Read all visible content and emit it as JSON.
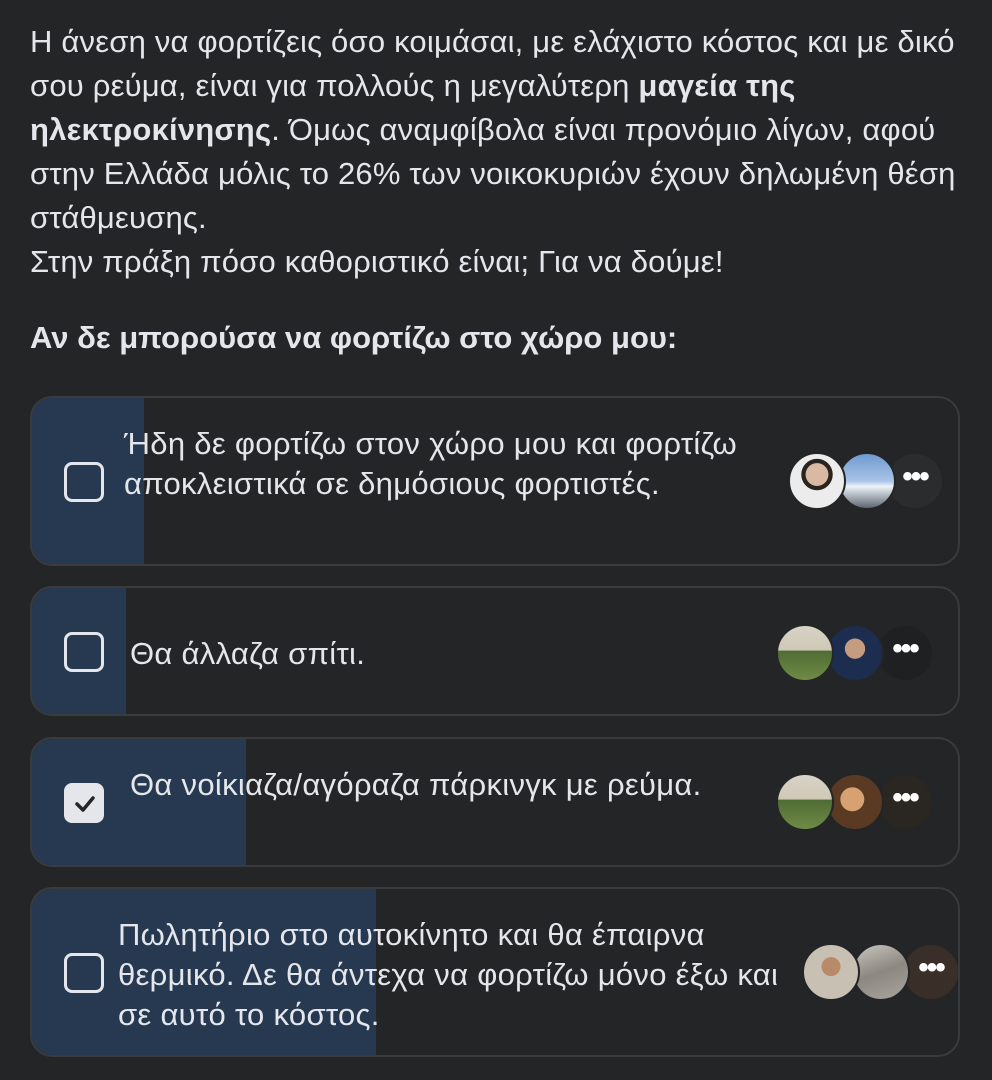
{
  "post": {
    "para1_part1": "Η άνεση να φορτίζεις όσο κοιμάσαι, με ελάχιστο κόστος και με δικό σου ρεύμα, είναι για πολλούς η μεγαλύτερη ",
    "para1_bold": "μαγεία της ηλεκτροκίνησης",
    "para1_part2": ". Όμως αναμφίβολα είναι προνόμιο λίγων, αφού στην Ελλάδα μόλις το 26% των νοικοκυριών έχουν δηλωμένη θέση στάθμευσης.",
    "para2": "Στην πράξη πόσο καθοριστικό είναι; Για να δούμε!"
  },
  "poll": {
    "question": "Αν δε μπορούσα να φορτίζω στο χώρο μου:",
    "options": [
      {
        "label": "Ήδη δε φορτίζω στον χώρο μου και φορτίζω αποκλειστικά σε δημόσιους φορτιστές.",
        "vote_share": 0.12,
        "checked": false,
        "voter_avatars": [
          "man-portrait-avatar",
          "snowy-landscape-avatar",
          "dark-photo-avatar"
        ]
      },
      {
        "label": "Θα άλλαζα σπίτι.",
        "vote_share": 0.1,
        "checked": false,
        "voter_avatars": [
          "park-bicycle-avatar",
          "man-sunglasses-avatar",
          "dark-bicycle-avatar"
        ]
      },
      {
        "label": "Θα νοίκιαζα/αγόραζα πάρκινγκ με ρεύμα.",
        "vote_share": 0.23,
        "checked": true,
        "voter_avatars": [
          "park-bicycle-avatar",
          "man-warm-light-avatar",
          "dark-portrait-avatar"
        ]
      },
      {
        "label": "Πωλητήριο στο αυτοκίνητο και θα έπαιρνα θερμικό. Δε θα άντεχα να φορτίζω μόνο έξω και σε αυτό το κόστος.",
        "vote_share": 0.37,
        "checked": false,
        "voter_avatars": [
          "man-outdoors-avatar",
          "rocky-mountain-avatar",
          "dark-photo-avatar"
        ]
      }
    ],
    "more_indicator": "•••"
  },
  "colors": {
    "background": "#242526",
    "text": "#e4e6eb",
    "option_border": "#3a3b3c",
    "vote_fill": "#263951"
  }
}
